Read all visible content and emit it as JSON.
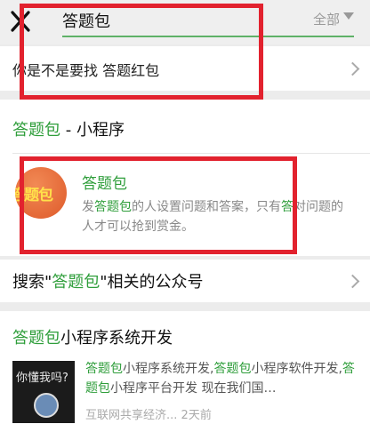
{
  "search": {
    "query": "答题包",
    "scope": "全部"
  },
  "suggestion": {
    "prefix": "你是不是要找 ",
    "term": "答题红包"
  },
  "mini_program": {
    "section_keyword": "答题包",
    "section_suffix": " - 小程序",
    "logo_text": "答题包",
    "name": "答题包",
    "desc_pre": "发",
    "desc_kw1": "答题包",
    "desc_mid": "的人设置问题和答案，只有",
    "desc_kw2": "答",
    "desc_post": "对问题的人才可以抢到赏金。"
  },
  "public_accounts": {
    "prefix": "搜索\"",
    "keyword": "答题包",
    "suffix": "\"相关的公众号"
  },
  "article": {
    "title_kw": "答题包",
    "title_rest": "小程序系统开发",
    "thumb_text": "你懂我吗?",
    "d1_kw": "答题包",
    "d1_text": "小程序系统开发,",
    "d2_kw": "答题包",
    "d2_text": "小程序软件开发,",
    "d3_kw": "答题包",
    "d3_text": "小程序平台开发 现在我们国…",
    "source": "互联网共享经济...",
    "time": "2天前"
  },
  "colors": {
    "highlight": "#2f9e3b",
    "annotation_red": "#e2222e"
  }
}
